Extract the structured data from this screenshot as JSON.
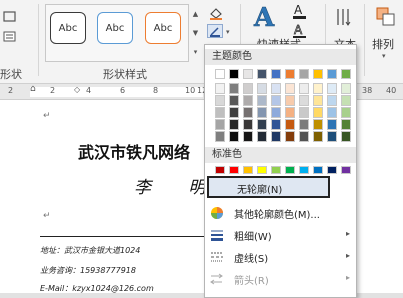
{
  "ribbon": {
    "left_group_label": "形状",
    "styles_group_label": "形状样式",
    "style_samples": [
      "Abc",
      "Abc",
      "Abc"
    ],
    "style_colors": [
      "#3a3a3a",
      "#5b9bd5",
      "#ed7d31"
    ],
    "wordart_label": "快速样式",
    "text_label": "文本",
    "arrange_label": "排列",
    "icons": [
      "shape-fill-icon",
      "shape-outline-icon",
      "wordart-a-icon",
      "text-fill-icon",
      "text-outline-icon",
      "text-direction-icon",
      "arrange-icon"
    ]
  },
  "ruler": {
    "numbers": [
      "2",
      "2",
      "4",
      "6",
      "8",
      "10",
      "12",
      "38",
      "40"
    ]
  },
  "document": {
    "title": "武汉市铁凡网络",
    "name": "李 明 有",
    "address_line": "地址：武汉市金银大道1024",
    "phone_line": "业务咨询：15938777918",
    "email_line": "E-Mail：kzyx1024@126.com"
  },
  "dropdown": {
    "theme_colors_label": "主题颜色",
    "standard_colors_label": "标准色",
    "theme_top_row": [
      "#ffffff",
      "#000000",
      "#e7e6e6",
      "#44546a",
      "#4472c4",
      "#ed7d31",
      "#a5a5a5",
      "#ffc000",
      "#5b9bd5",
      "#70ad47"
    ],
    "theme_shades": [
      [
        "#f2f2f2",
        "#7f7f7f",
        "#d0cece",
        "#d6dce4",
        "#d9e2f3",
        "#fbe5d5",
        "#ededed",
        "#fff2cc",
        "#deebf6",
        "#e2efd9"
      ],
      [
        "#d8d8d8",
        "#595959",
        "#aeabab",
        "#adb9ca",
        "#b4c6e7",
        "#f7cbac",
        "#dbdbdb",
        "#fee599",
        "#bdd7ee",
        "#c5e0b3"
      ],
      [
        "#bfbfbf",
        "#3f3f3f",
        "#757070",
        "#8496b0",
        "#8eaadb",
        "#f4b183",
        "#c9c9c9",
        "#ffd965",
        "#9dc3e6",
        "#a8d08d"
      ],
      [
        "#a5a5a5",
        "#262626",
        "#3a3838",
        "#323f4f",
        "#2f5496",
        "#c55a11",
        "#7b7b7b",
        "#bf9000",
        "#2e75b5",
        "#538135"
      ],
      [
        "#7f7f7f",
        "#0c0c0c",
        "#171616",
        "#222a35",
        "#1f3864",
        "#833c0b",
        "#525252",
        "#7f6000",
        "#1e4e79",
        "#375623"
      ]
    ],
    "standard_colors": [
      "#c00000",
      "#ff0000",
      "#ffc000",
      "#ffff00",
      "#92d050",
      "#00b050",
      "#00b0f0",
      "#0070c0",
      "#002060",
      "#7030a0"
    ],
    "items": [
      {
        "label": "无轮廓(N)",
        "arrow": ""
      },
      {
        "label": "其他轮廓颜色(M)...",
        "arrow": ""
      },
      {
        "label": "粗细(W)",
        "arrow": "▸"
      },
      {
        "label": "虚线(S)",
        "arrow": "▸"
      },
      {
        "label": "箭头(R)",
        "arrow": "▸"
      }
    ]
  }
}
